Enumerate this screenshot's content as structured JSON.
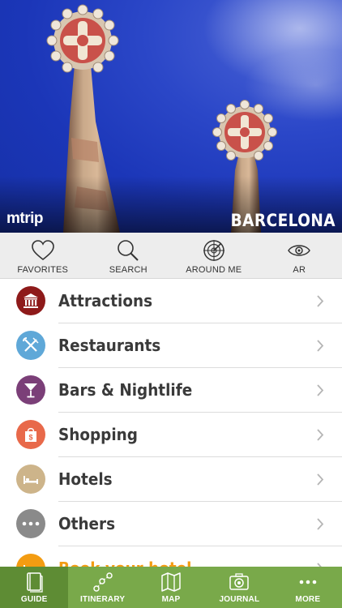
{
  "hero": {
    "brand": "mtrip",
    "city": "BARCELONA"
  },
  "quickbar": [
    {
      "label": "FAVORITES",
      "icon": "heart-icon"
    },
    {
      "label": "SEARCH",
      "icon": "search-icon"
    },
    {
      "label": "AROUND ME",
      "icon": "radar-icon"
    },
    {
      "label": "AR",
      "icon": "eye-icon"
    }
  ],
  "categories": [
    {
      "label": "Attractions",
      "icon": "museum-icon",
      "color": "#8e1a1a"
    },
    {
      "label": "Restaurants",
      "icon": "fork-knife-icon",
      "color": "#5fa8d8"
    },
    {
      "label": "Bars & Nightlife",
      "icon": "cocktail-icon",
      "color": "#7b3f78"
    },
    {
      "label": "Shopping",
      "icon": "shopping-bag-icon",
      "color": "#e8694a"
    },
    {
      "label": "Hotels",
      "icon": "bed-icon",
      "color": "#cdb48a"
    },
    {
      "label": "Others",
      "icon": "ellipsis-icon",
      "color": "#8a8a8a"
    },
    {
      "label": "Book your hotel",
      "icon": "bed-icon",
      "color": "#f39c12"
    }
  ],
  "tabbar": [
    {
      "label": "GUIDE",
      "icon": "book-icon",
      "active": true
    },
    {
      "label": "ITINERARY",
      "icon": "route-icon",
      "active": false
    },
    {
      "label": "MAP",
      "icon": "map-icon",
      "active": false
    },
    {
      "label": "JOURNAL",
      "icon": "camera-icon",
      "active": false
    },
    {
      "label": "MORE",
      "icon": "ellipsis-icon",
      "active": false
    }
  ]
}
